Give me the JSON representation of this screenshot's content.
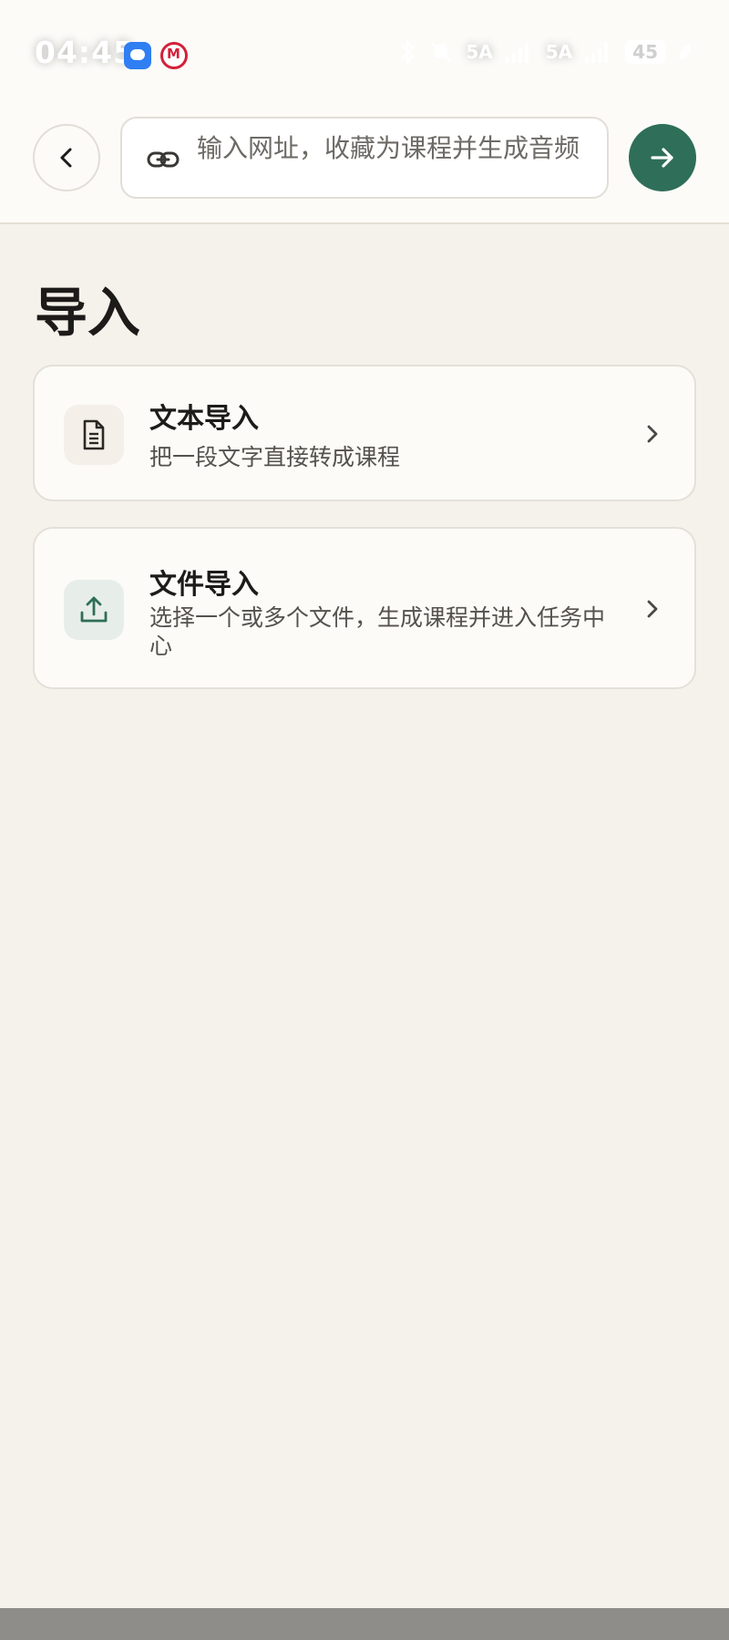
{
  "status_bar": {
    "time": "04:45",
    "signal_1": "5A",
    "signal_2": "5A",
    "battery": "45",
    "icons": [
      "message-app-icon",
      "bank-app-icon",
      "bluetooth-icon",
      "bell-muted-icon",
      "signal-icon",
      "battery-icon",
      "leaf-icon"
    ]
  },
  "topbar": {
    "url_placeholder": "输入网址，收藏为课程并生成音频",
    "back_icon": "chevron-left-icon",
    "link_icon": "link-icon",
    "go_icon": "arrow-right-icon"
  },
  "page": {
    "title": "导入"
  },
  "options": [
    {
      "title": "文本导入",
      "description": "把一段文字直接转成课程",
      "icon": "document-icon"
    },
    {
      "title": "文件导入",
      "description": "选择一个或多个文件，生成课程并进入任务中心",
      "icon": "upload-icon"
    }
  ],
  "colors": {
    "background": "#f5f2ec",
    "card": "#fcfbf8",
    "accent": "#2f6e58",
    "border": "#e4e0d8"
  }
}
